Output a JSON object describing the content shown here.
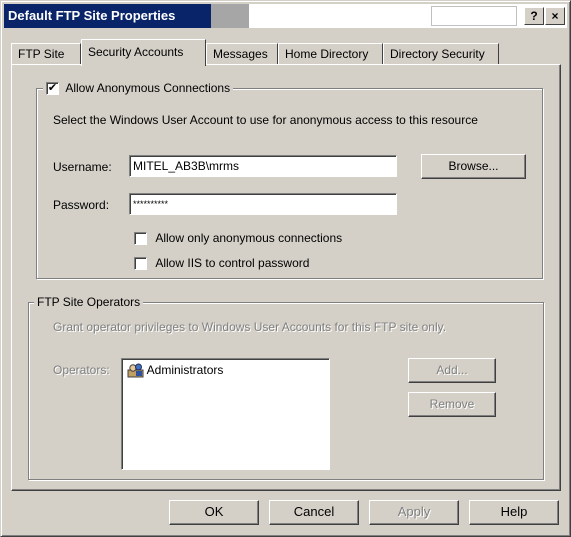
{
  "window": {
    "title": "Default FTP Site Properties",
    "help_button": "?",
    "close_button": "×"
  },
  "tabs": [
    {
      "label": "FTP Site",
      "active": false
    },
    {
      "label": "Security Accounts",
      "active": true
    },
    {
      "label": "Messages",
      "active": false
    },
    {
      "label": "Home Directory",
      "active": false
    },
    {
      "label": "Directory Security",
      "active": false
    }
  ],
  "anonymous": {
    "checkbox_label": "Allow Anonymous Connections",
    "checked": true,
    "description": "Select the Windows User Account to use for anonymous access to this resource",
    "username_label": "Username:",
    "username_value": "MITEL_AB3B\\mrms",
    "password_label": "Password:",
    "password_value": "**********",
    "browse_label": "Browse...",
    "only_anonymous_label": "Allow only anonymous connections",
    "only_anonymous_checked": false,
    "iis_password_label": "Allow IIS to control password",
    "iis_password_checked": false
  },
  "operators": {
    "group_label": "FTP Site Operators",
    "description": "Grant operator privileges to Windows User Accounts for this FTP site only.",
    "operators_label": "Operators:",
    "items": [
      "Administrators"
    ],
    "add_label": "Add...",
    "remove_label": "Remove"
  },
  "footer": {
    "ok": "OK",
    "cancel": "Cancel",
    "apply": "Apply",
    "help": "Help"
  },
  "icons": {
    "user-group": "group-icon",
    "check": "checkmark"
  }
}
